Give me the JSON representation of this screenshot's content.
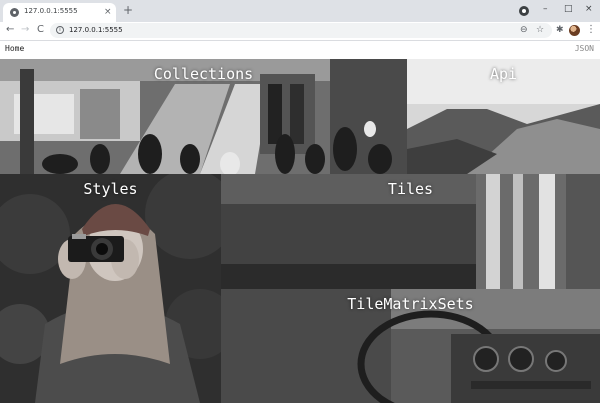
{
  "browser": {
    "tab_title": "127.0.0.1:5555",
    "tab_close": "×",
    "new_tab": "+",
    "url": "127.0.0.1:5555",
    "window": {
      "minimize": "–",
      "maximize": "□",
      "close": "×"
    },
    "nav": {
      "back": "←",
      "forward": "→",
      "reload": "C"
    },
    "icons": {
      "info": "i",
      "zoom": "⊖",
      "star": "☆",
      "extensions": "✱",
      "menu": "⋮"
    }
  },
  "header": {
    "home": "Home",
    "json": "JSON"
  },
  "tiles": [
    {
      "id": "collections",
      "label": "Collections"
    },
    {
      "id": "api",
      "label": "Api"
    },
    {
      "id": "styles",
      "label": "Styles"
    },
    {
      "id": "tiles",
      "label": "Tiles"
    },
    {
      "id": "tilematrixsets",
      "label": "TileMatrixSets"
    }
  ]
}
